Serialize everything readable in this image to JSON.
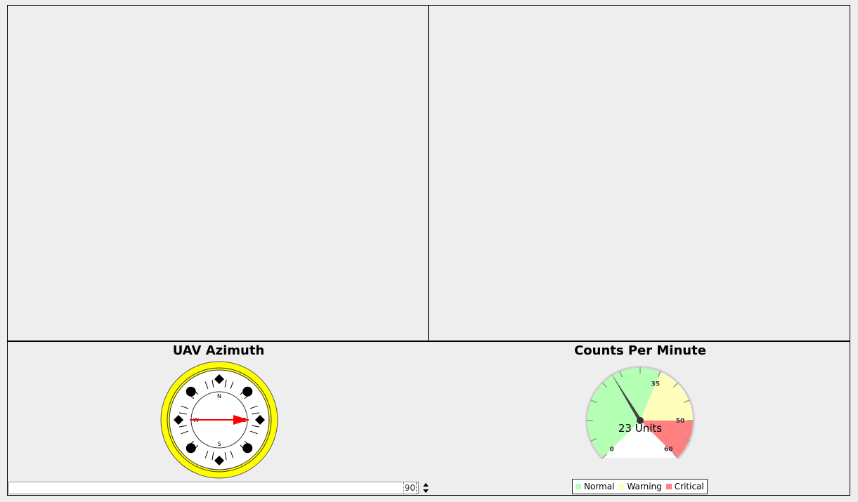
{
  "compass": {
    "title": "UAV Azimuth",
    "heading_degrees": 90,
    "labels": {
      "north": "N",
      "south": "S",
      "east": "E",
      "west": "W"
    },
    "colors": {
      "ring": "#ffff00",
      "face": "#ffffff",
      "needle": "#ff0000",
      "marks": "#000000"
    }
  },
  "azimuth_input": {
    "value": "90"
  },
  "gauge": {
    "title": "Counts Per Minute",
    "value": 23,
    "value_label": "23 Units",
    "min": 0,
    "max": 60,
    "tick_labels": [
      "0",
      "35",
      "50",
      "60"
    ],
    "ranges": [
      {
        "name": "Normal",
        "from": 0,
        "to": 35,
        "color": "#b5ffb5"
      },
      {
        "name": "Warning",
        "from": 35,
        "to": 50,
        "color": "#ffffbb"
      },
      {
        "name": "Critical",
        "from": 50,
        "to": 60,
        "color": "#ff8080"
      }
    ]
  }
}
